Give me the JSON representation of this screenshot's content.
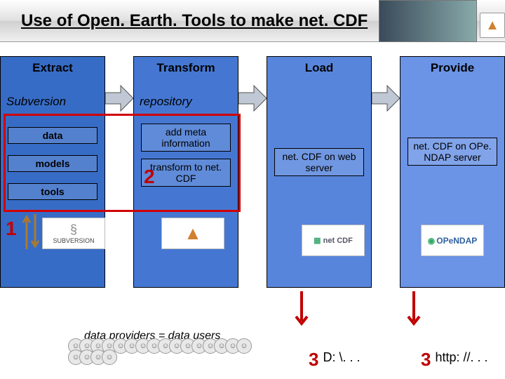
{
  "header": {
    "title": "Use of Open. Earth. Tools to make net. CDF"
  },
  "columns": {
    "extract": {
      "title": "Extract",
      "sub": "Subversion",
      "boxes": {
        "data": "data",
        "models": "models",
        "tools": "tools"
      }
    },
    "transform": {
      "title": "Transform",
      "sub": "repository",
      "boxes": {
        "meta": "add meta information",
        "tonc": "transform to net. CDF"
      }
    },
    "load": {
      "title": "Load",
      "boxes": {
        "web": "net. CDF on web server"
      }
    },
    "provide": {
      "title": "Provide",
      "boxes": {
        "opendap": "net. CDF on OPe. NDAP server"
      }
    }
  },
  "badges": {
    "one": "1",
    "two": "2",
    "three_a": "3",
    "three_b": "3"
  },
  "caption": "data providers = data users",
  "bottom": {
    "a": "D: \\. . .",
    "b": "http: //. . ."
  },
  "logos": {
    "subversion": "SUBVERSION",
    "matlab": "▲",
    "netcdf": "net CDF",
    "opendap": "OPeNDAP"
  }
}
